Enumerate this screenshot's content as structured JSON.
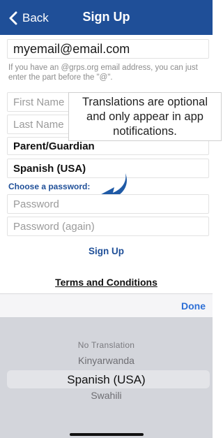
{
  "nav": {
    "back_label": "Back",
    "title": "Sign Up"
  },
  "form": {
    "email_value": "myemail@email.com",
    "email_hint": "If you have an @grps.org email address, you can just enter the part before the \"@\".",
    "first_name_placeholder": "First Name",
    "last_name_placeholder": "Last Name",
    "role_value": "Parent/Guardian",
    "language_value": "Spanish (USA)",
    "choose_password_label": "Choose a password:",
    "password_placeholder": "Password",
    "password_again_placeholder": "Password (again)",
    "signup_label": "Sign Up",
    "terms_label": "Terms and Conditions"
  },
  "tooltip": {
    "text": "Translations are optional and only appear in app notifications."
  },
  "picker": {
    "done_label": "Done",
    "options": [
      "No Translation",
      "Kinyarwanda",
      "Spanish (USA)",
      "Swahili"
    ],
    "selected": "Spanish (USA)"
  },
  "colors": {
    "brand_blue": "#1f4f98",
    "arrow_blue": "#1f5aa6",
    "done_blue": "#2d6fd6"
  }
}
